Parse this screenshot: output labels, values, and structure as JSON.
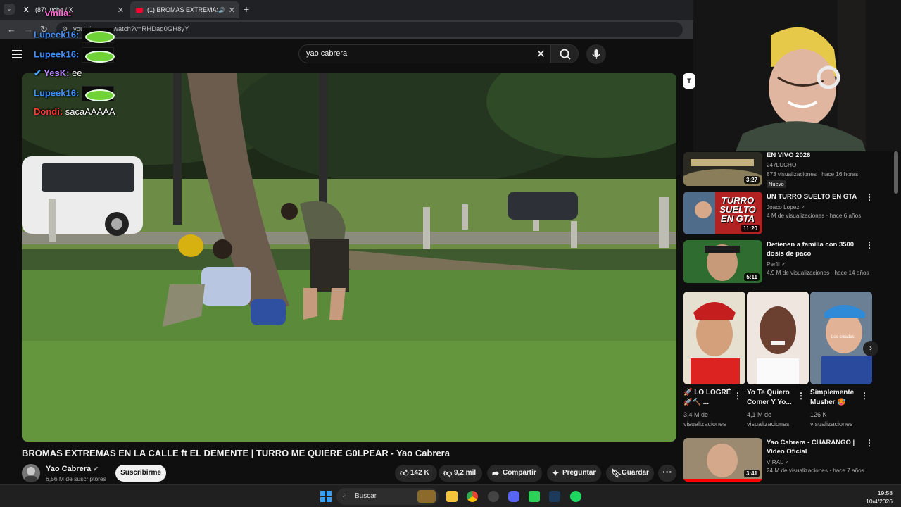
{
  "browser": {
    "tabs": [
      {
        "label": "(87) lucho / X"
      },
      {
        "label": "(1) BROMAS EXTREMAS EN",
        "active": true
      }
    ],
    "url": "youtube.com/watch?v=RHDag0GH8yY"
  },
  "search": {
    "query": "yao cabrera"
  },
  "chat": [
    {
      "user": "vmiia:",
      "color": "#ff6bd6",
      "msg": ""
    },
    {
      "user": "Lupeek16:",
      "color": "#3c8dff",
      "msg": ""
    },
    {
      "user": "Lupeek16:",
      "color": "#3c8dff",
      "msg": ""
    },
    {
      "user": "YesK:",
      "color": "#b98bff",
      "msg": "ee"
    },
    {
      "user": "Lupeek16:",
      "color": "#3c8dff",
      "msg": ""
    },
    {
      "user": "Dondi:",
      "color": "#ff3b3b",
      "msg": "sacaAAAAA"
    }
  ],
  "video": {
    "title": "BROMAS EXTREMAS EN LA CALLE ft EL DEMENTE | TURRO ME QUIERE G0LPEAR - Yao Cabrera",
    "channel": "Yao Cabrera",
    "subscribers": "6,56 M de suscriptores",
    "subscribe_label": "Suscribirme",
    "likes": "142 K",
    "dislikes": "9,2 mil",
    "share": "Compartir",
    "ask": "Preguntar",
    "save": "Guardar",
    "more": "···"
  },
  "sidebar": {
    "items": [
      {
        "title": "EN VIVO 2026",
        "channel": "247LUCHO",
        "meta": "873 visualizaciones · hace 16 horas",
        "badge": "Nuevo",
        "duration": "3:27"
      },
      {
        "title": "UN TURRO SUELTO EN GTA",
        "channel": "Joaco Lopez ✓",
        "meta": "4 M de visualizaciones · hace 6 años",
        "duration": "11:20",
        "thumb_text": "TURRO SUELTO EN GTA"
      },
      {
        "title": "Detienen a familia con 3500 dosis de paco",
        "channel": "Perfil ✓",
        "meta": "4,9 M de visualizaciones · hace 14 años",
        "duration": "5:11"
      },
      {
        "title": "Yao Cabrera - CHARANGO | Video Oficial",
        "channel": "VIRAL ✓",
        "meta": "24 M de visualizaciones · hace 7 años",
        "duration": "3:41"
      }
    ],
    "shorts": [
      {
        "title": "🚀 LO LOGRÉ 🚀🔨 ...",
        "meta": "3,4 M de visualizaciones"
      },
      {
        "title": "Yo Te Quiero Comer Y Yo...",
        "meta": "4,1 M de visualizaciones"
      },
      {
        "title": "Simplemente Musher 🥵",
        "meta": "126 K visualizaciones",
        "thumb_text": "Los creadas."
      }
    ]
  },
  "taskbar": {
    "search_label": "Buscar",
    "time": "19:58",
    "date": "10/4/2026"
  }
}
